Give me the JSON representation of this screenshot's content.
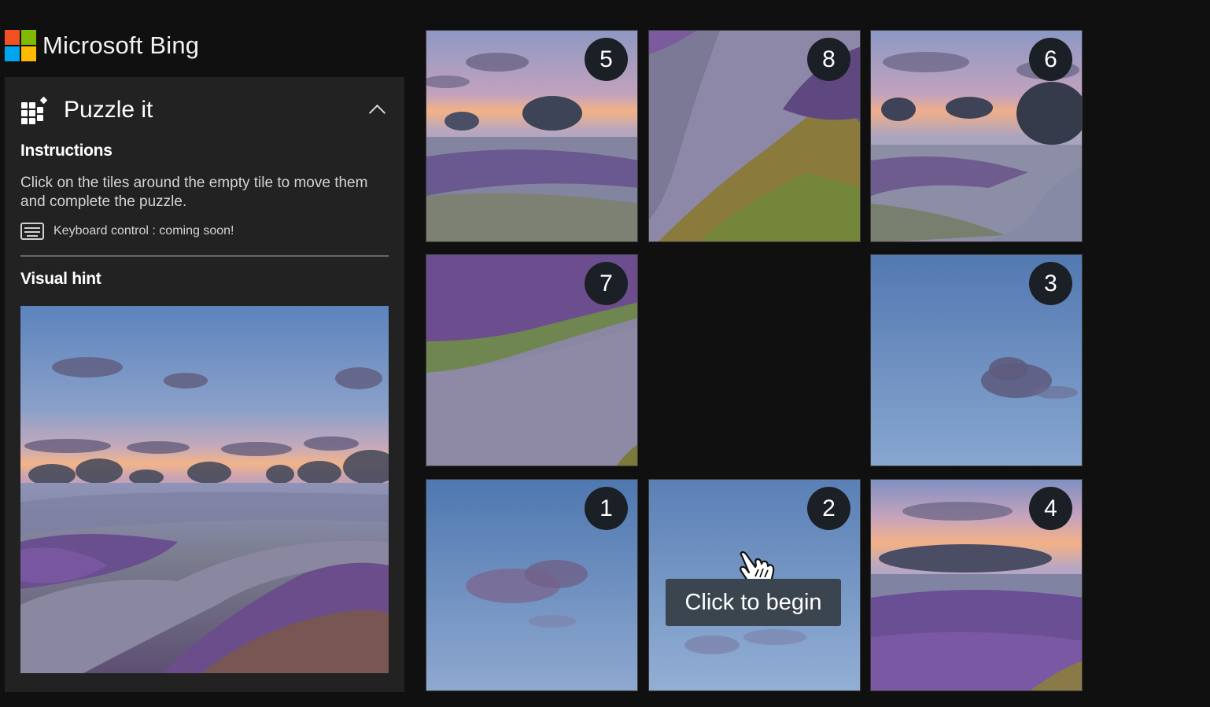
{
  "brand": {
    "name": "Microsoft Bing",
    "logo_colors": [
      "#f25022",
      "#7fba00",
      "#00a4ef",
      "#ffb900"
    ]
  },
  "panel": {
    "title": "Puzzle it",
    "icon": "puzzle-grid-icon",
    "collapse_icon": "chevron-up-icon",
    "instructions_heading": "Instructions",
    "instructions_text": "Click on the tiles around the empty tile to move them and complete the puzzle.",
    "keyboard_icon": "keyboard-icon",
    "keyboard_note": "Keyboard control : coming soon!",
    "visual_hint_heading": "Visual hint"
  },
  "board": {
    "tiles": [
      {
        "number": "5",
        "scene": "sunset-trees-fog"
      },
      {
        "number": "8",
        "scene": "heather-slope-path"
      },
      {
        "number": "6",
        "scene": "trees-winding-path"
      },
      {
        "number": "7",
        "scene": "heather-sandy-path"
      },
      {
        "number": "",
        "scene": "empty"
      },
      {
        "number": "3",
        "scene": "sky-cloud"
      },
      {
        "number": "1",
        "scene": "sky-pink-cloud"
      },
      {
        "number": "2",
        "scene": "sky-light"
      },
      {
        "number": "4",
        "scene": "sunset-heather-field"
      }
    ],
    "start_tooltip": "Click to begin",
    "cursor_icon": "hand-pointer-icon"
  },
  "colors": {
    "background": "#101010",
    "panel": "#222222",
    "badge": "#1b1f26",
    "tooltip": "#3b4550"
  }
}
